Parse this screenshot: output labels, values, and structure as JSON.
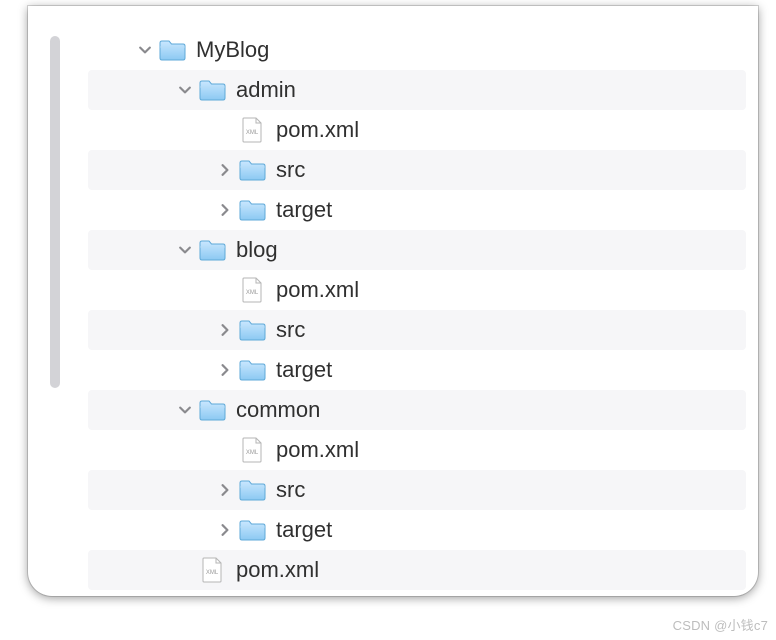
{
  "watermark": "CSDN @小钱c7",
  "tree": {
    "rows": [
      {
        "label": "MyBlog",
        "depth": 0,
        "icon": "folder",
        "chev": "down",
        "alt": false
      },
      {
        "label": "admin",
        "depth": 1,
        "icon": "folder",
        "chev": "down",
        "alt": true
      },
      {
        "label": "pom.xml",
        "depth": 2,
        "icon": "xml",
        "chev": "none",
        "alt": false
      },
      {
        "label": "src",
        "depth": 2,
        "icon": "folder",
        "chev": "right",
        "alt": true
      },
      {
        "label": "target",
        "depth": 2,
        "icon": "folder",
        "chev": "right",
        "alt": false
      },
      {
        "label": "blog",
        "depth": 1,
        "icon": "folder",
        "chev": "down",
        "alt": true
      },
      {
        "label": "pom.xml",
        "depth": 2,
        "icon": "xml",
        "chev": "none",
        "alt": false
      },
      {
        "label": "src",
        "depth": 2,
        "icon": "folder",
        "chev": "right",
        "alt": true
      },
      {
        "label": "target",
        "depth": 2,
        "icon": "folder",
        "chev": "right",
        "alt": false
      },
      {
        "label": "common",
        "depth": 1,
        "icon": "folder",
        "chev": "down",
        "alt": true
      },
      {
        "label": "pom.xml",
        "depth": 2,
        "icon": "xml",
        "chev": "none",
        "alt": false
      },
      {
        "label": "src",
        "depth": 2,
        "icon": "folder",
        "chev": "right",
        "alt": true
      },
      {
        "label": "target",
        "depth": 2,
        "icon": "folder",
        "chev": "right",
        "alt": false
      },
      {
        "label": "pom.xml",
        "depth": 1,
        "icon": "xml",
        "chev": "none",
        "alt": true
      }
    ]
  },
  "indentPx": 40
}
